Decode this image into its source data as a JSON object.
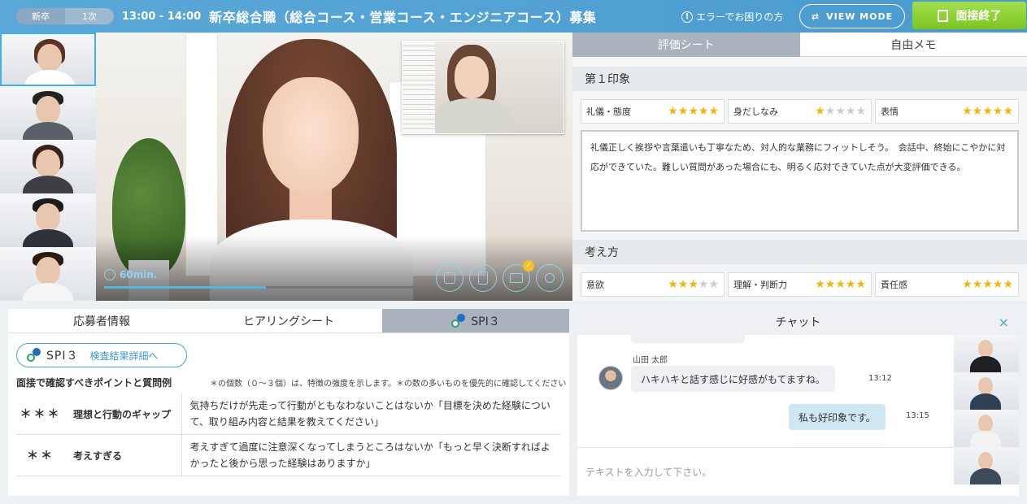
{
  "header": {
    "badge_type": "新卒",
    "badge_round": "1次",
    "time": "13:00 - 14:00",
    "title": "新卒総合職（総合コース・営業コース・エンジニアコース）募集",
    "error_link": "エラーでお困りの方",
    "error_icon": "!",
    "view_mode": "VIEW MODE",
    "end_button": "面接終了"
  },
  "video": {
    "timer": "60min.",
    "progress_fraction": 0.5,
    "controls": [
      "camera-icon",
      "document-icon",
      "profile-card-icon",
      "user-remove-icon"
    ],
    "check_mark": "✓"
  },
  "evaluation": {
    "tabs": [
      "評価シート",
      "自由メモ"
    ],
    "section1": "第１印象",
    "ratings1": [
      {
        "label": "礼儀・態度",
        "stars": 5
      },
      {
        "label": "身だしなみ",
        "stars": 1
      },
      {
        "label": "表情",
        "stars": 5
      }
    ],
    "memo": "礼儀正しく挨拶や言葉遣いも丁寧なため、対人的な業務にフィットしそう。　会話中、終始にこやかに対応ができていた。難しい質問があった場合にも、明るく応対できていた点が大変評価できる。",
    "section2": "考え方",
    "ratings2": [
      {
        "label": "意欲",
        "stars": 3
      },
      {
        "label": "理解・判断力",
        "stars": 5
      },
      {
        "label": "責任感",
        "stars": 5
      }
    ]
  },
  "bottom": {
    "tabs": [
      "応募者情報",
      "ヒアリングシート",
      "SPI３"
    ],
    "spi_logo": "SPI３",
    "spi_link": "検査結果詳細へ",
    "question_heading": "面接で確認すべきポイントと質問例",
    "question_note": "＊の個数（０～３個）は、特徴の強度を示します。＊の数の多いものを優先的に確認してください",
    "rows": [
      {
        "mark": "＊＊＊",
        "point": "理想と行動のギャップ",
        "question": "気持ちだけが先走って行動がともなわないことはないか「目標を決めた経験について、取り組み内容と結果を教えてください」"
      },
      {
        "mark": "＊＊",
        "point": "考えすぎる",
        "question": "考えすぎて過度に注意深くなってしまうところはないか「もっと早く決断すればよかったと後から思った経験はありますか」"
      }
    ]
  },
  "chat": {
    "title": "チャット",
    "close_icon": "×",
    "sender": "山田 太郎",
    "message1": "ハキハキと話す感じに好感がもてますね。",
    "time1": "13:12",
    "message2": "私も好印象です。",
    "time2": "13:15",
    "input_placeholder": "テキストを入力して下さい。"
  },
  "colors": {
    "accent": "#43a6dc",
    "header": "#4a9ad0",
    "end_button": "#8fd13a",
    "star": "#f2b705"
  }
}
